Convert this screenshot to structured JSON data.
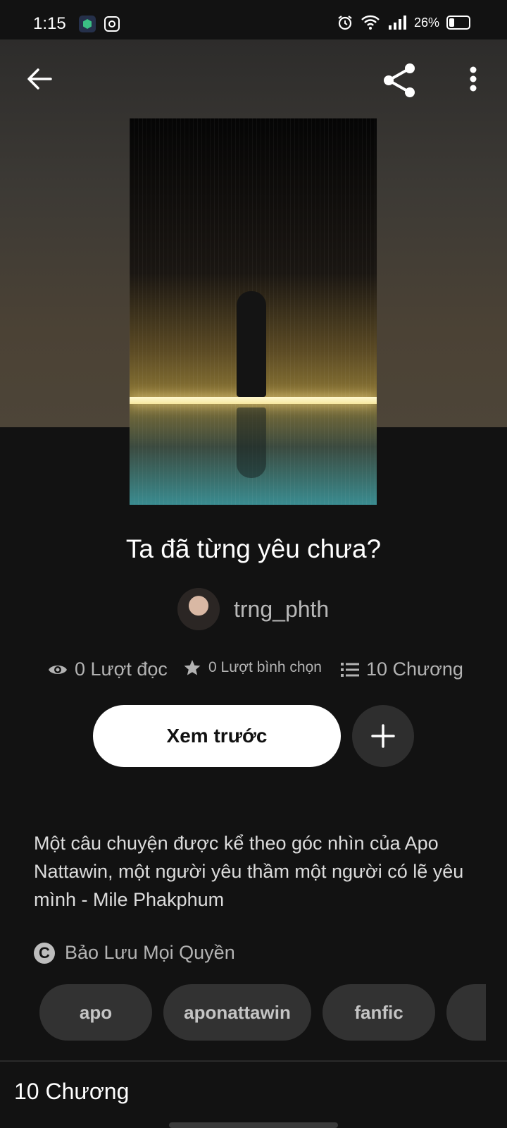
{
  "status_bar": {
    "time": "1:15",
    "battery": "26%",
    "icons": [
      "security-app-icon",
      "instagram-icon",
      "alarm-icon",
      "wifi-icon",
      "signal-icon",
      "battery-icon"
    ]
  },
  "header": {
    "back_icon": "arrow-left-icon",
    "share_icon": "share-icon",
    "more_icon": "more-vertical-icon"
  },
  "story": {
    "title": "Ta đã từng yêu chưa?",
    "author": "trng_phth",
    "stats": {
      "reads": "0 Lượt đọc",
      "votes": "0 Lượt bình chọn",
      "parts": "10 Chương"
    },
    "preview_button": "Xem trước",
    "add_icon": "plus-icon",
    "description": "Một câu chuyện được kể theo góc nhìn của Apo Nattawin,  một người yêu thầm một người có lẽ yêu mình - Mile Phakphum",
    "copyright": "Bảo Lưu Mọi Quyền",
    "copyright_icon": "copyright-icon",
    "tags": [
      "apo",
      "aponattawin",
      "fanfic",
      ""
    ]
  },
  "chapters_section": {
    "title": "10 Chương"
  },
  "colors": {
    "background": "#121212",
    "hero": "#4b4235",
    "button": "#ffffff",
    "tag": "#323232"
  }
}
